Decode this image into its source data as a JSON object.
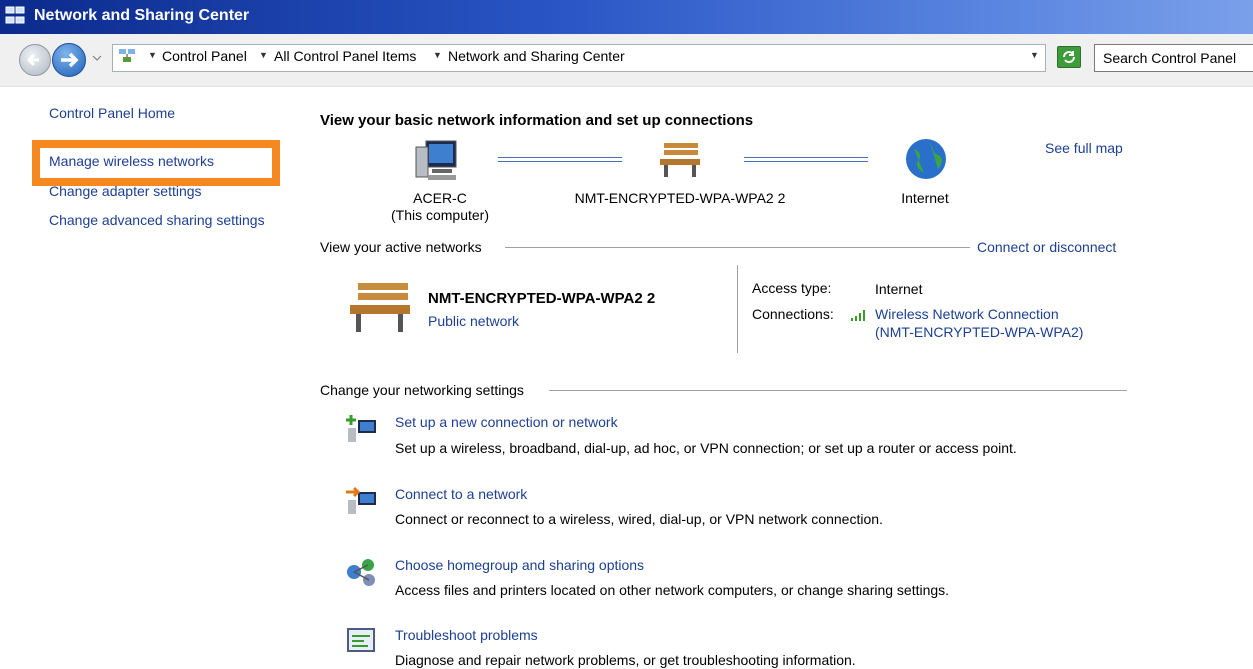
{
  "window": {
    "title": "Network and Sharing Center"
  },
  "address_bar": {
    "crumbs": [
      "Control Panel",
      "All Control Panel Items",
      "Network and Sharing Center"
    ],
    "search_placeholder": "Search Control Panel"
  },
  "sidebar": {
    "items": [
      {
        "label": "Control Panel Home"
      },
      {
        "label": "Manage wireless networks"
      },
      {
        "label": "Change adapter settings"
      },
      {
        "label": "Change advanced sharing settings"
      }
    ]
  },
  "main": {
    "heading": "View your basic network information and set up connections",
    "see_full_map": "See full map",
    "map": {
      "computer_name": "ACER-C",
      "computer_sub": "(This computer)",
      "network_name": "NMT-ENCRYPTED-WPA-WPA2  2",
      "internet": "Internet"
    },
    "active_networks": {
      "title": "View your active networks",
      "connect_link": "Connect or disconnect",
      "network_name": "NMT-ENCRYPTED-WPA-WPA2  2",
      "network_type": "Public network",
      "access_type_label": "Access type:",
      "access_type_value": "Internet",
      "connections_label": "Connections:",
      "connection_link_line1": "Wireless Network Connection",
      "connection_link_line2": "(NMT-ENCRYPTED-WPA-WPA2)"
    },
    "change_settings": {
      "title": "Change your networking settings",
      "items": [
        {
          "label": "Set up a new connection or network",
          "desc": "Set up a wireless, broadband, dial-up, ad hoc, or VPN connection; or set up a router or access point.",
          "icon": "new-connection-icon"
        },
        {
          "label": "Connect to a network",
          "desc": "Connect or reconnect to a wireless, wired, dial-up, or VPN network connection.",
          "icon": "connect-network-icon"
        },
        {
          "label": "Choose homegroup and sharing options",
          "desc": "Access files and printers located on other network computers, or change sharing settings.",
          "icon": "homegroup-icon"
        },
        {
          "label": "Troubleshoot problems",
          "desc": "Diagnose and repair network problems, or get troubleshooting information.",
          "icon": "troubleshoot-icon"
        }
      ]
    }
  },
  "colors": {
    "link": "#1c3f94",
    "highlight": "#f5891f"
  }
}
